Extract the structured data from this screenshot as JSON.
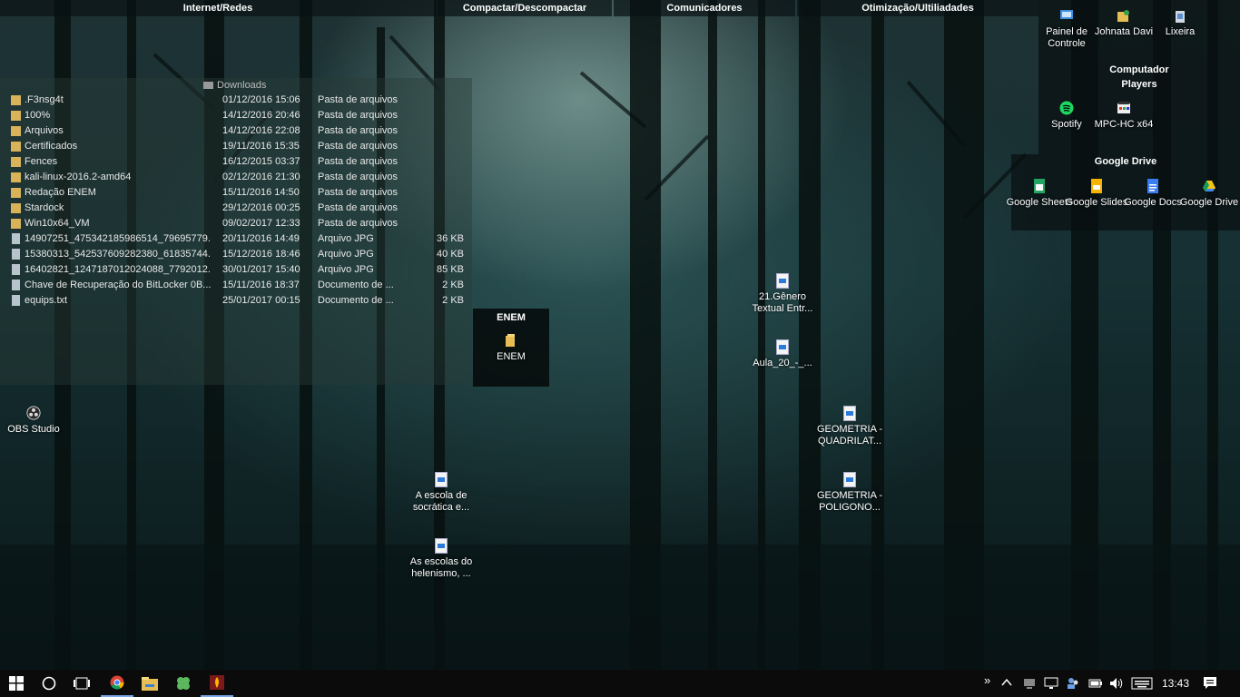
{
  "fence_bars": [
    {
      "label": "Internet/Redes"
    },
    {
      "label": "Compactar/Descompactar"
    },
    {
      "label": "Comunicadores"
    },
    {
      "label": "Otimização/Ultiliadades"
    }
  ],
  "top_right_icons": [
    {
      "label": "Painel de Controle",
      "icon": "control-panel-icon"
    },
    {
      "label": "Johnata Davi",
      "icon": "user-folder-icon"
    },
    {
      "label": "Lixeira",
      "icon": "recycle-bin-icon"
    }
  ],
  "computador_fence": {
    "title": "Computador"
  },
  "players_fence": {
    "title": "Players",
    "items": [
      {
        "label": "Spotify",
        "icon": "spotify-icon"
      },
      {
        "label": "MPC-HC x64",
        "icon": "mpc-hc-icon"
      }
    ]
  },
  "gdrive_fence": {
    "title": "Google Drive",
    "items": [
      {
        "label": "Google Sheets",
        "icon": "google-sheets-icon"
      },
      {
        "label": "Google Slides",
        "icon": "google-slides-icon"
      },
      {
        "label": "Google Docs",
        "icon": "google-docs-icon"
      },
      {
        "label": "Google Drive",
        "icon": "google-drive-icon"
      }
    ]
  },
  "downloads": {
    "title": "Downloads",
    "rows": [
      {
        "name": ".F3nsg4t",
        "date": "01/12/2016 15:06",
        "type": "Pasta de arquivos",
        "size": "",
        "kind": "folder"
      },
      {
        "name": "100%",
        "date": "14/12/2016 20:46",
        "type": "Pasta de arquivos",
        "size": "",
        "kind": "folder"
      },
      {
        "name": "Arquivos",
        "date": "14/12/2016 22:08",
        "type": "Pasta de arquivos",
        "size": "",
        "kind": "folder"
      },
      {
        "name": "Certificados",
        "date": "19/11/2016 15:35",
        "type": "Pasta de arquivos",
        "size": "",
        "kind": "folder"
      },
      {
        "name": "Fences",
        "date": "16/12/2015 03:37",
        "type": "Pasta de arquivos",
        "size": "",
        "kind": "folder"
      },
      {
        "name": "kali-linux-2016.2-amd64",
        "date": "02/12/2016 21:30",
        "type": "Pasta de arquivos",
        "size": "",
        "kind": "folder"
      },
      {
        "name": "Redação ENEM",
        "date": "15/11/2016 14:50",
        "type": "Pasta de arquivos",
        "size": "",
        "kind": "folder"
      },
      {
        "name": "Stardock",
        "date": "29/12/2016 00:25",
        "type": "Pasta de arquivos",
        "size": "",
        "kind": "folder"
      },
      {
        "name": "Win10x64_VM",
        "date": "09/02/2017 12:33",
        "type": "Pasta de arquivos",
        "size": "",
        "kind": "folder"
      },
      {
        "name": "14907251_475342185986514_79695779...",
        "date": "20/11/2016 14:49",
        "type": "Arquivo JPG",
        "size": "36 KB",
        "kind": "file"
      },
      {
        "name": "15380313_542537609282380_61835744...",
        "date": "15/12/2016 18:46",
        "type": "Arquivo JPG",
        "size": "40 KB",
        "kind": "file"
      },
      {
        "name": "16402821_1247187012024088_7792012...",
        "date": "30/01/2017 15:40",
        "type": "Arquivo JPG",
        "size": "85 KB",
        "kind": "file"
      },
      {
        "name": "Chave de Recuperação do BitLocker 0B...",
        "date": "15/11/2016 18:37",
        "type": "Documento de ...",
        "size": "2 KB",
        "kind": "file"
      },
      {
        "name": "equips.txt",
        "date": "25/01/2017 00:15",
        "type": "Documento de ...",
        "size": "2 KB",
        "kind": "file"
      }
    ]
  },
  "enem_fence": {
    "title": "ENEM",
    "item": "ENEM"
  },
  "desktop_icons": [
    {
      "label": "OBS Studio",
      "icon": "obs-studio-icon"
    },
    {
      "label": "21.Gênero Textual Entr...",
      "icon": "document-icon"
    },
    {
      "label": "Aula_20_-_...",
      "icon": "document-icon"
    },
    {
      "label": "GEOMETRIA - QUADRILAT...",
      "icon": "document-icon"
    },
    {
      "label": "GEOMETRIA - POLIGONO...",
      "icon": "document-icon"
    },
    {
      "label": "A escola de socrática e...",
      "icon": "document-icon"
    },
    {
      "label": "As escolas do helenismo, ...",
      "icon": "document-icon"
    }
  ],
  "taskbar": {
    "clock": "13:43",
    "apps": [
      "start-icon",
      "search-icon",
      "task-view-icon",
      "chrome-icon",
      "file-explorer-icon",
      "clover-icon",
      "app-icon"
    ],
    "tray": [
      "chevron-icon",
      "up-arrow-icon",
      "network-icon",
      "display-icon",
      "people-icon",
      "battery-icon",
      "volume-icon",
      "keyboard-icon",
      "notification-icon"
    ]
  }
}
